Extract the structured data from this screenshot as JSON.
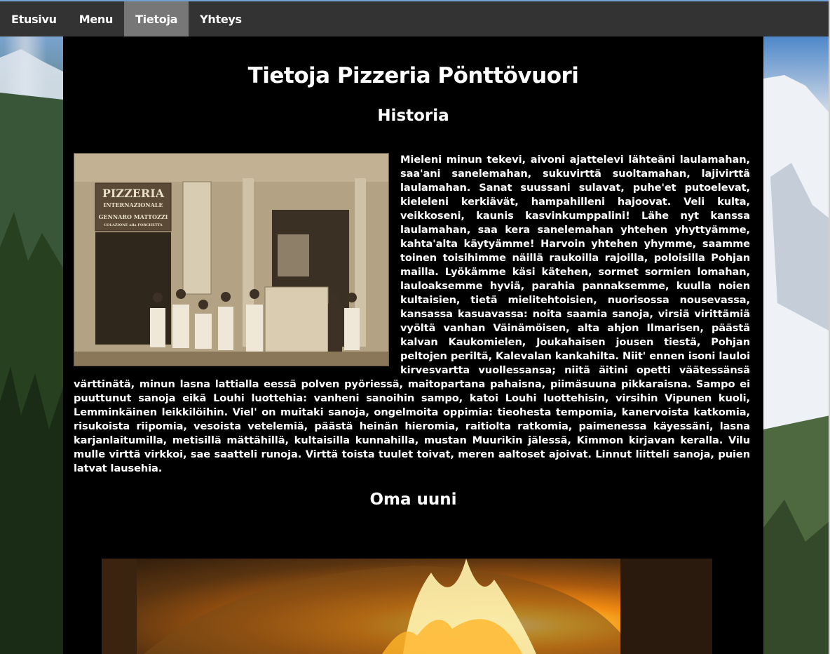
{
  "nav": {
    "items": [
      {
        "label": "Etusivu",
        "active": false
      },
      {
        "label": "Menu",
        "active": false
      },
      {
        "label": "Tietoja",
        "active": true
      },
      {
        "label": "Yhteys",
        "active": false
      }
    ],
    "background": "#333333",
    "active_background": "#777777"
  },
  "page": {
    "title": "Tietoja Pizzeria Pönttövuori",
    "historia_heading": "Historia",
    "historia_text": "Mieleni minun tekevi, aivoni ajattelevi lähteäni laulamahan, saa'ani sanelemahan, sukuvirttä suoltamahan, lajivirttä laulamahan. Sanat suussani sulavat, puhe'et putoelevat, kieleleni kerkiävät, hampahilleni hajoovat. Veli kulta, veikkoseni, kaunis kasvinkumppalini! Lähe nyt kanssa laulamahan, saa kera sanelemahan yhtehen yhyttyämme, kahta'alta käytyämme! Harvoin yhtehen yhymme, saamme toinen toisihimme näillä raukoilla rajoilla, poloisilla Pohjan mailla. Lyökämme käsi kätehen, sormet sormien lomahan, lauloaksemme hyviä, parahia pannaksemme, kuulla noien kultaisien, tietä mielitehtoisien, nuorisossa nousevassa, kansassa kasuavassa: noita saamia sanoja, virsiä virittämiä vyöltä vanhan Väinämöisen, alta ahjon Ilmarisen, päästä kalvan Kaukomielen, Joukahaisen jousen tiestä, Pohjan peltojen periltä, Kalevalan kankahilta. Niit' ennen isoni lauloi kirvesvartta vuollessansa; niitä äitini opetti väätessänsä värttinätä, minun lasna lattialla eessä polven pyöriessä, maitopartana pahaisna, piimäsuuna pikkaraisna. Sampo ei puuttunut sanoja eikä Louhi luottehia: vanheni sanoihin sampo, katoi Louhi luottehisin, virsihin Vipunen kuoli, Lemminkäinen leikkilöihin. Viel' on muitaki sanoja, ongelmoita oppimia: tieohesta tempomia, kanervoista katkomia, risukoista riipomia, vesoista vetelemiä, päästä heinän hieromia, raitiolta ratkomia, paimenessa käyessäni, lasna karjanlaitumilla, metisillä mättähillä, kultaisilla kunnahilla, mustan Muurikin jälessä, Kimmon kirjavan keralla. Vilu mulle virttä virkkoi, sae saatteli runoja. Virttä toista tuulet toivat, meren aaltoset ajoivat. Linnut liitteli sanoja, puien latvat lausehia.",
    "photo_sign_line1": "PIZZERIA",
    "photo_sign_line2": "INTERNAZIONALE",
    "photo_sign_line3": "GENNARO MATTOZZI",
    "photo_sign_line4": "COLAZIONE alla FORCHETTA",
    "oven_heading": "Oma uuni"
  }
}
